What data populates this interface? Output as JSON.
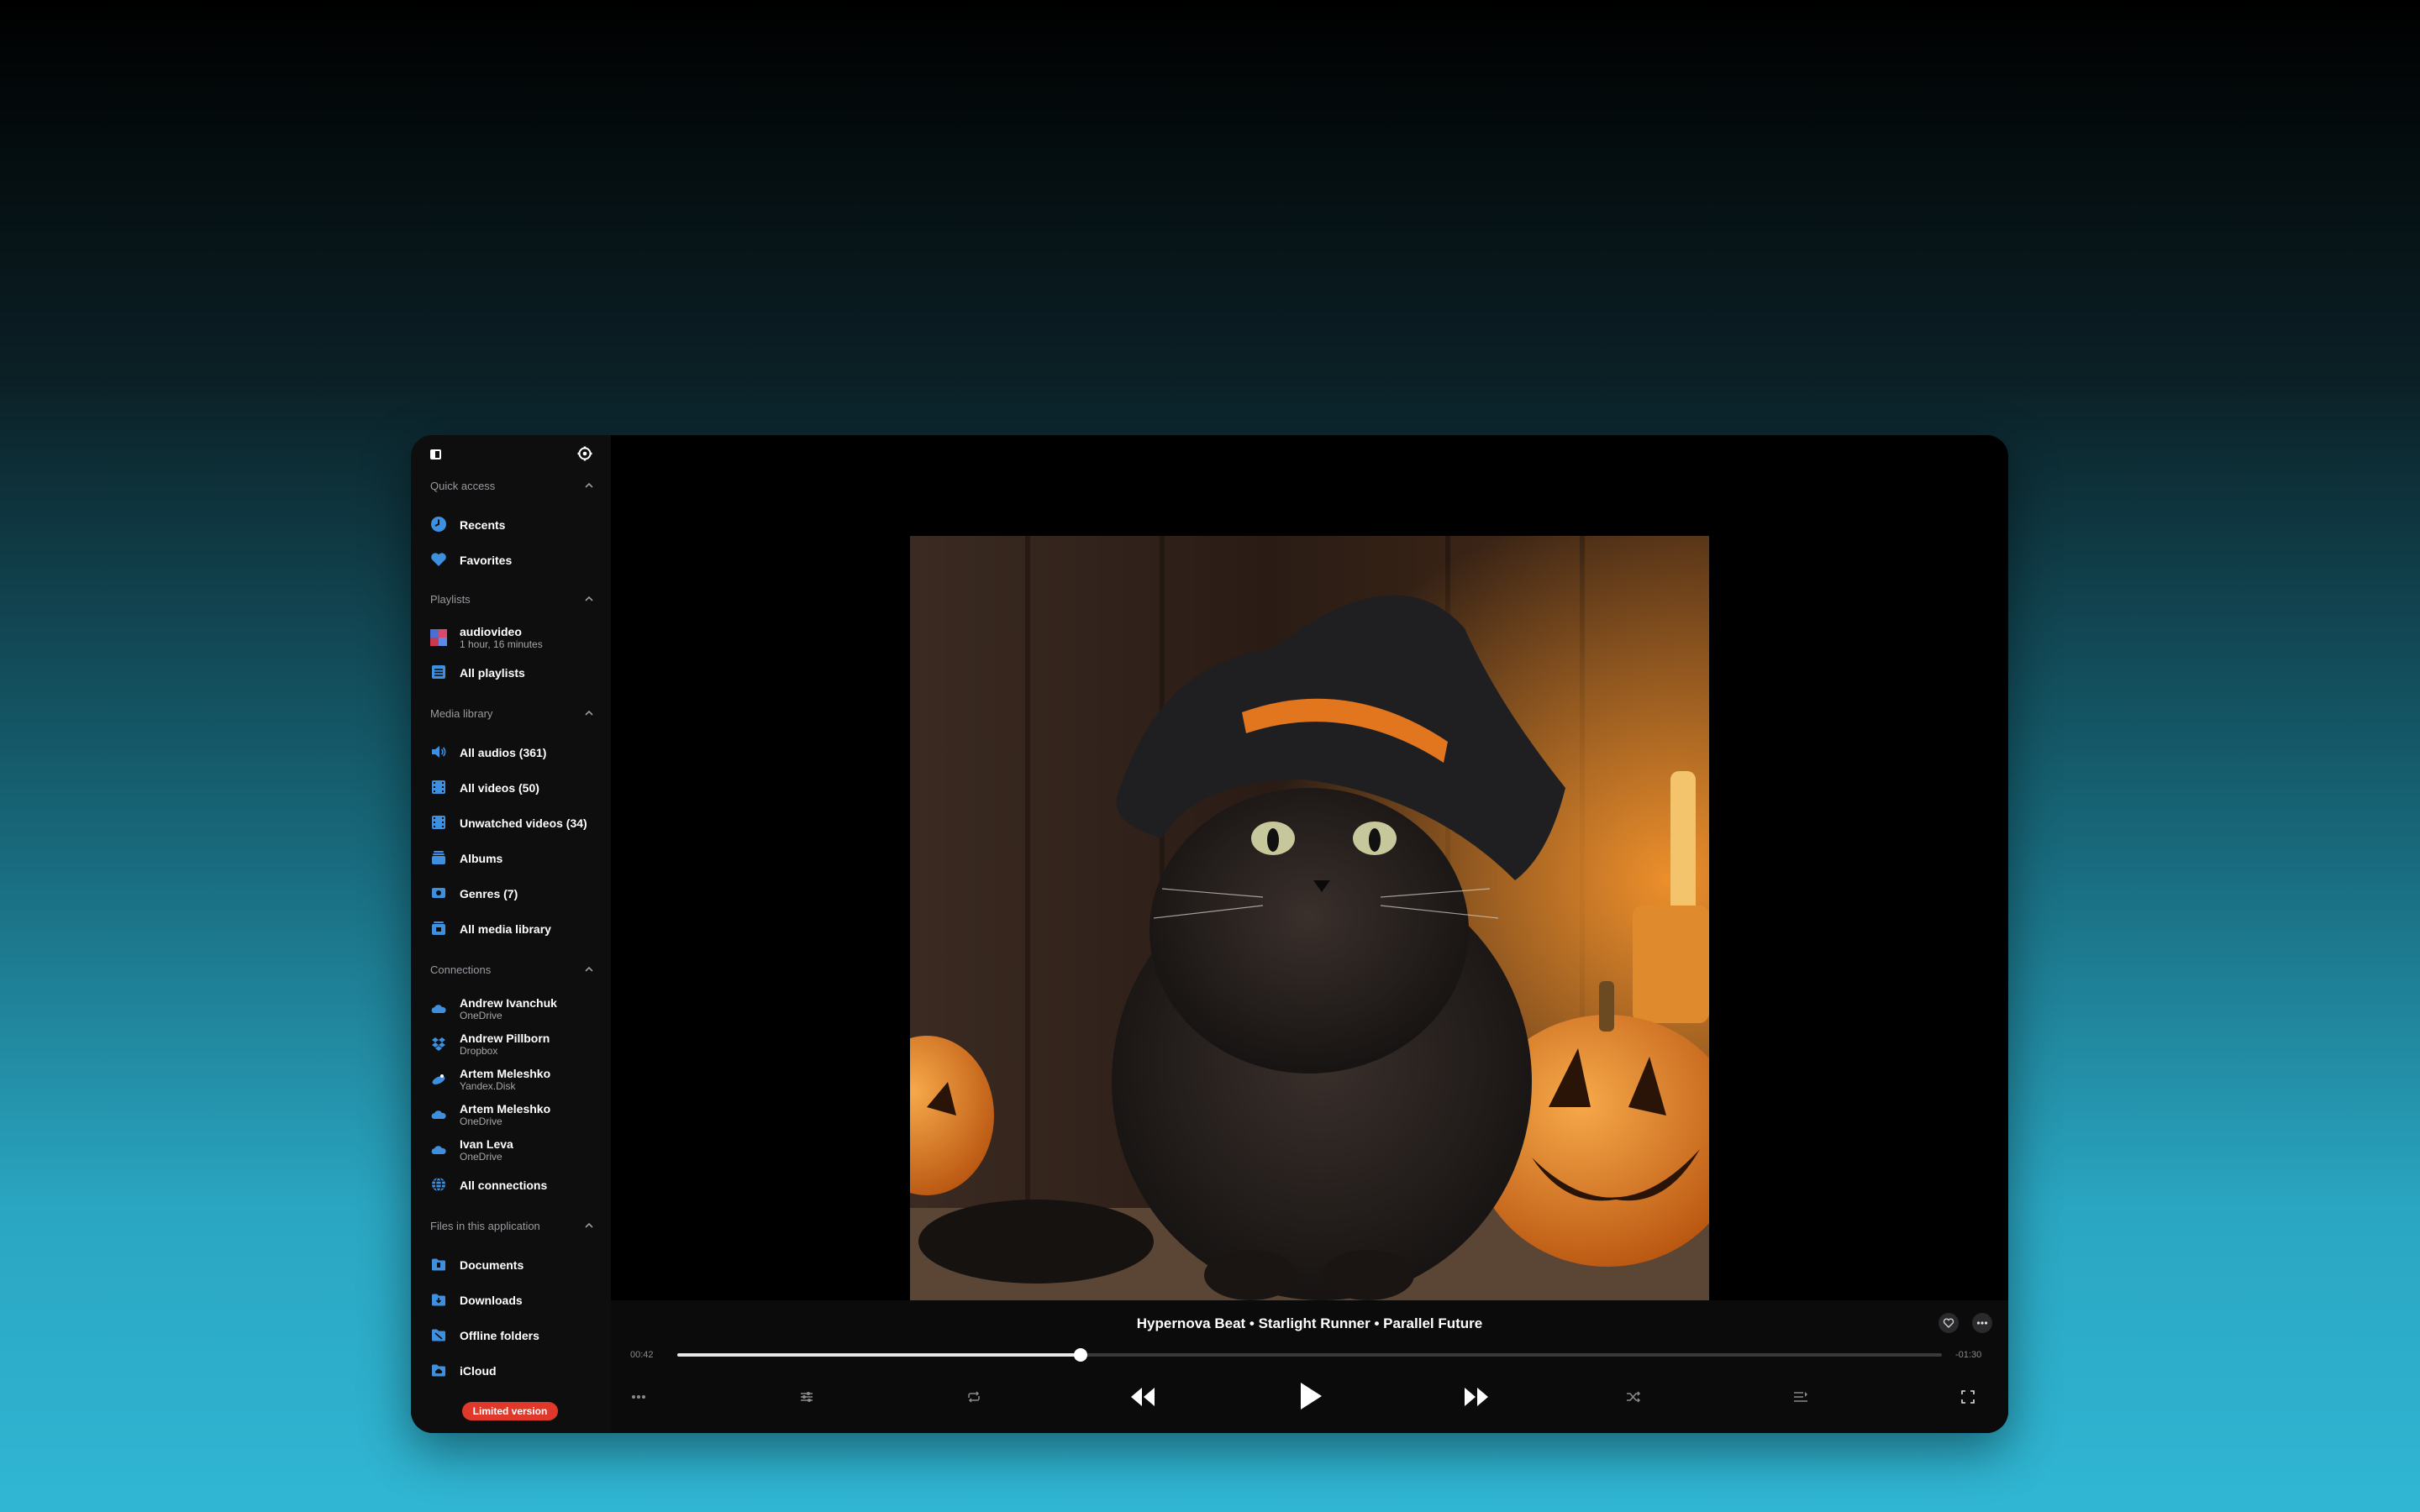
{
  "sidebar": {
    "sections": {
      "quick_access": "Quick access",
      "playlists": "Playlists",
      "media_library": "Media library",
      "connections": "Connections",
      "files": "Files in this application"
    },
    "quick_access": [
      {
        "label": "Recents",
        "icon": "clock-icon"
      },
      {
        "label": "Favorites",
        "icon": "heart-icon"
      }
    ],
    "playlists": [
      {
        "label": "audiovideo",
        "sub": "1 hour, 16 minutes",
        "icon": "playlist-cover-icon"
      },
      {
        "label": "All playlists",
        "icon": "list-icon"
      }
    ],
    "media_library": [
      {
        "label": "All audios (361)",
        "icon": "speaker-icon"
      },
      {
        "label": "All videos (50)",
        "icon": "film-icon"
      },
      {
        "label": "Unwatched videos (34)",
        "icon": "film-icon"
      },
      {
        "label": "Albums",
        "icon": "album-stack-icon"
      },
      {
        "label": "Genres (7)",
        "icon": "genre-icon"
      },
      {
        "label": "All media library",
        "icon": "library-icon"
      }
    ],
    "connections": [
      {
        "label": "Andrew Ivanchuk",
        "sub": "OneDrive",
        "icon": "onedrive-icon"
      },
      {
        "label": "Andrew Pillborn",
        "sub": "Dropbox",
        "icon": "dropbox-icon"
      },
      {
        "label": "Artem Meleshko",
        "sub": "Yandex.Disk",
        "icon": "yandex-disk-icon"
      },
      {
        "label": "Artem Meleshko",
        "sub": "OneDrive",
        "icon": "onedrive-icon"
      },
      {
        "label": "Ivan Leva",
        "sub": "OneDrive",
        "icon": "onedrive-icon"
      },
      {
        "label": "All connections",
        "icon": "globe-icon"
      }
    ],
    "files": [
      {
        "label": "Documents",
        "icon": "folder-documents-icon"
      },
      {
        "label": "Downloads",
        "icon": "folder-downloads-icon"
      },
      {
        "label": "Offline folders",
        "icon": "folder-offline-icon"
      },
      {
        "label": "iCloud",
        "icon": "folder-icloud-icon"
      }
    ],
    "limited_badge": "Limited version"
  },
  "player": {
    "title": "Hypernova Beat • Starlight Runner • Parallel Future",
    "elapsed": "00:42",
    "remaining": "-01:30",
    "progress_fraction": 0.319
  },
  "colors": {
    "accent_blue": "#3d8fe0",
    "badge_red": "#e0392b"
  }
}
